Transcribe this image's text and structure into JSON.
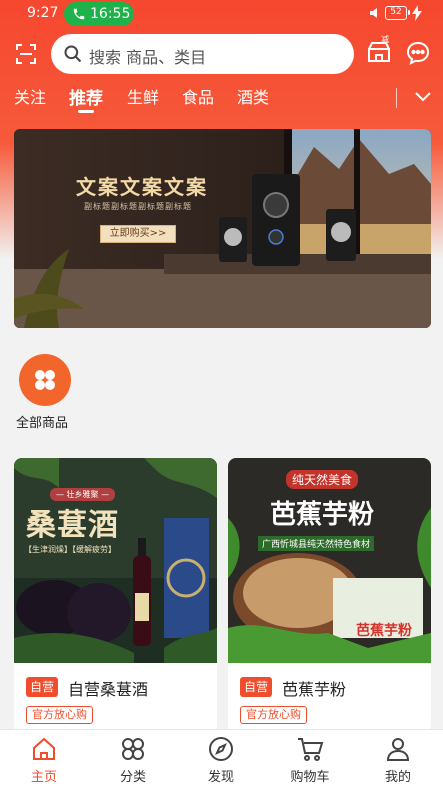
{
  "status_bar": {
    "time": "9:27",
    "call_time": "16:55",
    "battery": "52"
  },
  "search": {
    "placeholder": "搜索 商品、类目"
  },
  "shop_badge": "减",
  "categories": [
    {
      "label": "关注",
      "active": false
    },
    {
      "label": "推荐",
      "active": true
    },
    {
      "label": "生鲜",
      "active": false
    },
    {
      "label": "食品",
      "active": false
    },
    {
      "label": "酒类",
      "active": false
    }
  ],
  "banner": {
    "title": "文案文案文案",
    "subtitle": "副标题副标题副标题副标题",
    "button": "立即购买>>"
  },
  "all_goods": {
    "label": "全部商品"
  },
  "products": [
    {
      "image_title": "桑葚酒",
      "image_top": "— 壮乡雅聚 —",
      "image_tagline": "【生津润燥】【缓解疲劳】",
      "self_tag": "自营",
      "name": "自营桑葚酒",
      "official_tag": "官方放心购"
    },
    {
      "image_title": "芭蕉芋粉",
      "image_top": "纯天然美食",
      "image_tagline": "广西忻城县纯天然特色食材",
      "image_box": "芭蕉芋粉",
      "self_tag": "自营",
      "name": "芭蕉芋粉",
      "official_tag": "官方放心购"
    }
  ],
  "nav": [
    {
      "label": "主页",
      "icon": "home-icon",
      "active": true
    },
    {
      "label": "分类",
      "icon": "category-icon",
      "active": false
    },
    {
      "label": "发现",
      "icon": "compass-icon",
      "active": false
    },
    {
      "label": "购物车",
      "icon": "cart-icon",
      "active": false
    },
    {
      "label": "我的",
      "icon": "user-icon",
      "active": false
    }
  ],
  "colors": {
    "brand": "#f6472f",
    "accent": "#f04d2c",
    "call_green": "#20b24a",
    "orange_circle": "#f3662b"
  }
}
